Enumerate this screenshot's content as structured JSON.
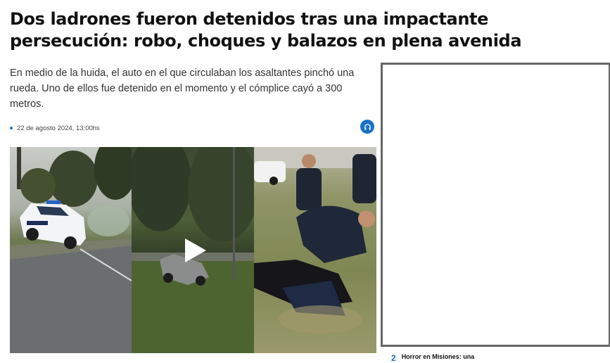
{
  "article": {
    "headline": "Dos ladrones fueron detenidos tras una impactante persecución: robo, choques y balazos en plena avenida",
    "summary": "En medio de la huida, el auto en el que circulaban los asaltantes pinchó una rueda. Uno de ellos fue detenido en el momento y el cómplice cayó a 300 metros.",
    "date": "22 de agosto 2024, 13:00hs"
  },
  "media": {
    "play_icon": "play-icon",
    "audio_icon": "headphones-icon"
  },
  "related": {
    "number": "2",
    "title": "Horror en Misiones: una"
  },
  "colors": {
    "accent": "#1a73c9",
    "ad_border": "#666666"
  }
}
